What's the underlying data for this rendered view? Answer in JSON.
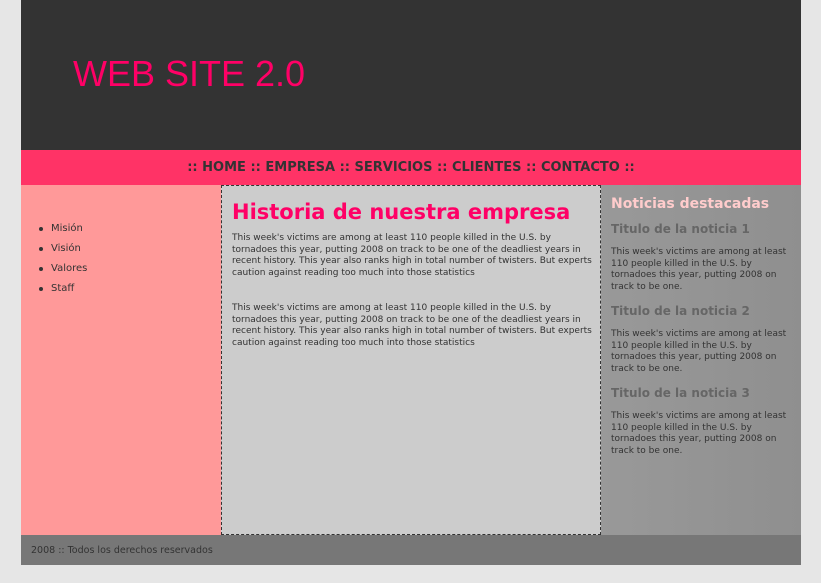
{
  "header": {
    "title": "WEB SITE 2.0"
  },
  "nav": {
    "separator": "::",
    "items": [
      {
        "label": "HOME"
      },
      {
        "label": "EMPRESA"
      },
      {
        "label": "SERVICIOS"
      },
      {
        "label": "CLIENTES"
      },
      {
        "label": "CONTACTO"
      }
    ]
  },
  "sidebar": {
    "items": [
      {
        "label": "Misión"
      },
      {
        "label": "Visión"
      },
      {
        "label": "Valores"
      },
      {
        "label": "Staff"
      }
    ]
  },
  "main": {
    "heading": "Historia de nuestra empresa",
    "paragraphs": [
      "This week's victims are among at least 110 people killed in the U.S. by tornadoes this year, putting 2008 on track to be one of the deadliest years in recent history. This year also ranks high in total number of twisters. But experts caution against reading too much into those statistics",
      "This week's victims are among at least 110 people killed in the U.S. by tornadoes this year, putting 2008 on track to be one of the deadliest years in recent history. This year also ranks high in total number of twisters. But experts caution against reading too much into those statistics"
    ]
  },
  "news": {
    "heading": "Noticias destacadas",
    "items": [
      {
        "title": "Titulo de la noticia 1",
        "text": "This week's victims are among at least 110 people killed in the U.S. by tornadoes this year, putting 2008 on track to be one."
      },
      {
        "title": "Titulo de la noticia 2",
        "text": "This week's victims are among at least 110 people killed in the U.S. by tornadoes this year, putting 2008 on track to be one."
      },
      {
        "title": "Titulo de la noticia 3",
        "text": "This week's victims are among at least 110 people killed in the U.S. by tornadoes this year, putting 2008 on track to be one."
      }
    ]
  },
  "footer": {
    "text": "2008 :: Todos los derechos reservados"
  },
  "colors": {
    "page_background": "#e6e6e6",
    "header_background": "#333333",
    "accent": "#ff0066",
    "nav_background": "#ff3366",
    "sidebar_background": "#ff9999",
    "main_background": "#cccccc",
    "news_background": "#999999",
    "news_heading": "#ffcccc",
    "footer_background": "#777777"
  }
}
